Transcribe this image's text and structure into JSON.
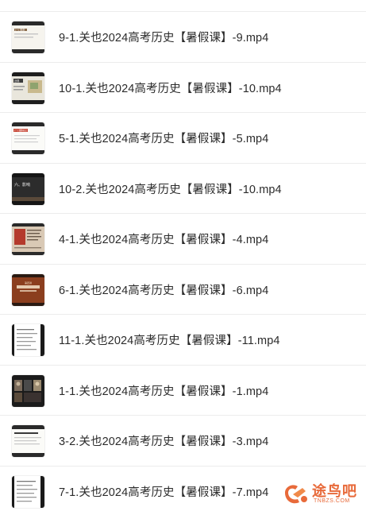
{
  "files": [
    {
      "name": "9-1.关也2024高考历史【暑假课】-9.mp4",
      "thumb_icon": "slide-thumbnail-white-icon",
      "thumb_text": "(一) 隋唐"
    },
    {
      "name": "10-1.关也2024高考历史【暑假课】-10.mp4",
      "thumb_icon": "slide-thumbnail-map-icon",
      "thumb_text": "近现"
    },
    {
      "name": "5-1.关也2024高考历史【暑假课】-5.mp4",
      "thumb_icon": "slide-thumbnail-white-icon",
      "thumb_text": "(一) 课题标记"
    },
    {
      "name": "10-2.关也2024高考历史【暑假课】-10.mp4",
      "thumb_icon": "slide-thumbnail-dark-icon",
      "thumb_text": "六、影响"
    },
    {
      "name": "4-1.关也2024高考历史【暑假课】-4.mp4",
      "thumb_icon": "slide-thumbnail-document-icon",
      "thumb_text": ""
    },
    {
      "name": "6-1.关也2024高考历史【暑假课】-6.mp4",
      "thumb_icon": "slide-thumbnail-brown-icon",
      "thumb_text": "第四讲"
    },
    {
      "name": "11-1.关也2024高考历史【暑假课】-11.mp4",
      "thumb_icon": "slide-thumbnail-text-icon",
      "thumb_text": ""
    },
    {
      "name": "1-1.关也2024高考历史【暑假课】-1.mp4",
      "thumb_icon": "slide-thumbnail-photo-icon",
      "thumb_text": ""
    },
    {
      "name": "3-2.关也2024高考历史【暑假课】-3.mp4",
      "thumb_icon": "slide-thumbnail-white-icon",
      "thumb_text": ""
    },
    {
      "name": "7-1.关也2024高考历史【暑假课】-7.mp4",
      "thumb_icon": "slide-thumbnail-text-icon",
      "thumb_text": ""
    }
  ],
  "watermark": {
    "text": "途鸟吧",
    "sub": "TNBZS.COM",
    "color": "#e86a3a"
  }
}
